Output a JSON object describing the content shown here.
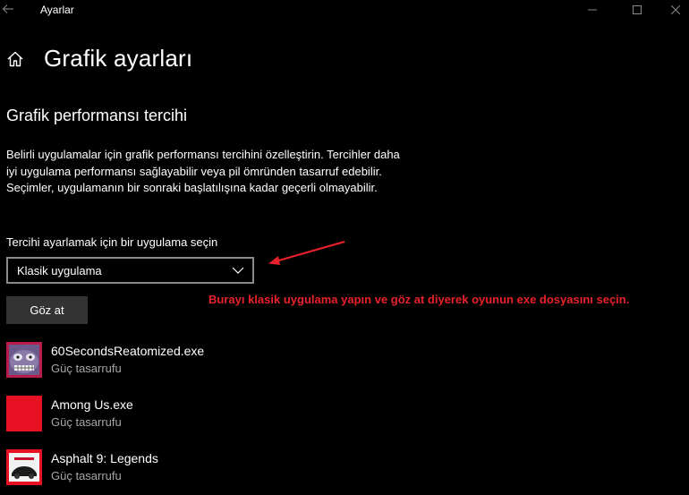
{
  "window": {
    "title": "Ayarlar",
    "icons": [
      "back-arrow-icon",
      "minimize-icon",
      "maximize-icon",
      "close-icon"
    ]
  },
  "header": {
    "title": "Grafik ayarları",
    "icon": "home-icon"
  },
  "section": {
    "title": "Grafik performansı tercihi",
    "description": "Belirli uygulamalar için grafik performansı tercihini özelleştirin. Tercihler daha iyi uygulama performansı sağlayabilir veya pil ömründen tasarruf edebilir. Seçimler, uygulamanın bir sonraki başlatılışına kadar geçerli olmayabilir.",
    "select_label": "Tercihi ayarlamak için bir uygulama seçin",
    "selected_value": "Klasik uygulama",
    "browse_label": "Göz at"
  },
  "annotation": {
    "text": "Burayı klasik uygulama yapın ve göz at diyerek oyunun exe dosyasını seçin.",
    "color": "#e8212a"
  },
  "apps": [
    {
      "name": "60SecondsReatomized.exe",
      "preference": "Güç tasarrufu",
      "icon": "game-icon-60seconds"
    },
    {
      "name": "Among Us.exe",
      "preference": "Güç tasarrufu",
      "icon": "game-icon-among-us"
    },
    {
      "name": "Asphalt 9: Legends",
      "preference": "Güç tasarrufu",
      "icon": "game-icon-asphalt"
    }
  ],
  "colors": {
    "background": "#000000",
    "accent_red": "#e81123",
    "button": "#333333",
    "secondary_text": "#a6a6a6"
  }
}
